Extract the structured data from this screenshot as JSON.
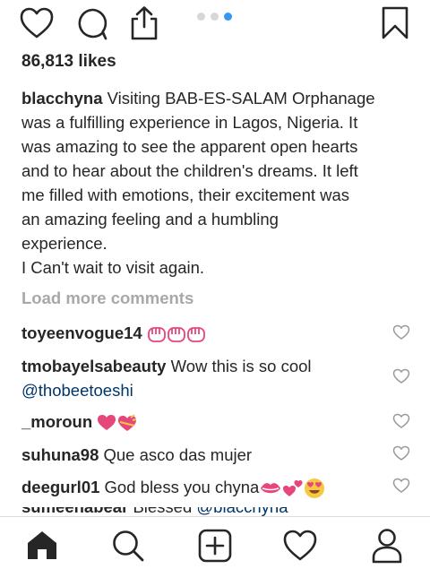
{
  "post": {
    "likes": "86,813 likes",
    "caption": {
      "username": "blacchyna",
      "lines": [
        "Visiting BAB-ES-SALAM Orphanage",
        "was a fulfilling experience in Lagos, Nigeria. It",
        "was amazing to see the apparent open hearts",
        "and to hear about the children's dreams. It left",
        "me filled with emotions, their excitement was",
        "an amazing feeling and a humbling",
        "experience.",
        "I Can't wait to visit again."
      ]
    },
    "load_more": "Load more comments",
    "carousel": {
      "count": 3,
      "active_index": 2
    }
  },
  "comments": [
    {
      "username": "toyeenvogue14",
      "text": "",
      "emoji": [
        "raised-fists-icon",
        "raised-fists-icon",
        "raised-fists-icon"
      ]
    },
    {
      "username": "tmobayelsabeauty",
      "text": "Wow this is so cool",
      "mention": "@thobeetoeshi"
    },
    {
      "username": "_moroun",
      "text": "",
      "emoji": [
        "heart-icon",
        "heart-with-ribbon-icon"
      ]
    },
    {
      "username": "suhuna98",
      "text": "Que asco das mujer"
    },
    {
      "username": "deegurl01",
      "text": "God bless you chyna",
      "emoji": [
        "kiss-mark-icon",
        "two-hearts-icon",
        "heart-eyes-icon"
      ]
    }
  ],
  "partial_comment": {
    "username": "sumeenabear",
    "text": "Blessed",
    "mention": "@blacchyna"
  },
  "colors": {
    "text": "#262626",
    "muted": "#a8a8a8",
    "mention": "#003569",
    "carousel_active": "#3897f0",
    "carousel_inactive": "#d7d7d7",
    "emoji_pink": "#e7467b"
  },
  "tabbar": [
    "home-icon",
    "search-icon",
    "new-post-icon",
    "activity-heart-icon",
    "profile-icon"
  ]
}
